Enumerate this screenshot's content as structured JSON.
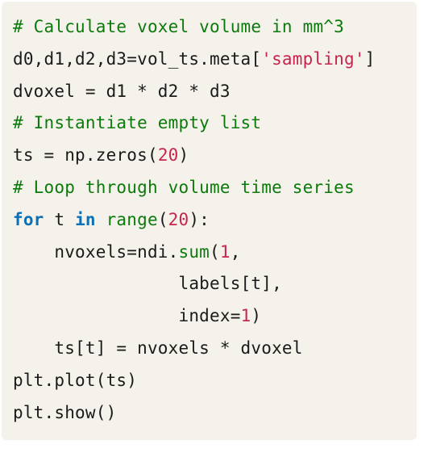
{
  "code_block": {
    "lines": [
      [
        {
          "type": "comment",
          "text": "# Calculate voxel volume in mm^3"
        }
      ],
      [
        {
          "type": "plain",
          "text": "d0,d1,d2,d3=vol_ts.meta["
        },
        {
          "type": "string",
          "text": "'sampling'"
        },
        {
          "type": "plain",
          "text": "]"
        }
      ],
      [
        {
          "type": "plain",
          "text": "dvoxel = d1 * d2 * d3"
        }
      ],
      [
        {
          "type": "comment",
          "text": "# Instantiate empty list"
        }
      ],
      [
        {
          "type": "plain",
          "text": "ts = np.zeros("
        },
        {
          "type": "number",
          "text": "20"
        },
        {
          "type": "plain",
          "text": ")"
        }
      ],
      [
        {
          "type": "comment",
          "text": "# Loop through volume time series"
        }
      ],
      [
        {
          "type": "keyword",
          "text": "for"
        },
        {
          "type": "plain",
          "text": " t "
        },
        {
          "type": "keyword",
          "text": "in"
        },
        {
          "type": "plain",
          "text": " "
        },
        {
          "type": "builtin",
          "text": "range"
        },
        {
          "type": "plain",
          "text": "("
        },
        {
          "type": "number",
          "text": "20"
        },
        {
          "type": "plain",
          "text": "):"
        }
      ],
      [
        {
          "type": "plain",
          "text": "    nvoxels=ndi."
        },
        {
          "type": "builtin",
          "text": "sum"
        },
        {
          "type": "plain",
          "text": "("
        },
        {
          "type": "number",
          "text": "1"
        },
        {
          "type": "plain",
          "text": ","
        }
      ],
      [
        {
          "type": "plain",
          "text": "                labels[t],"
        }
      ],
      [
        {
          "type": "plain",
          "text": "                index="
        },
        {
          "type": "number",
          "text": "1"
        },
        {
          "type": "plain",
          "text": ")"
        }
      ],
      [
        {
          "type": "plain",
          "text": "    ts[t] = nvoxels * dvoxel"
        }
      ],
      [
        {
          "type": "plain",
          "text": "plt.plot(ts)"
        }
      ],
      [
        {
          "type": "plain",
          "text": "plt.show()"
        }
      ]
    ]
  },
  "colors": {
    "background": "#f5f2eb",
    "comment": "#0b7a0b",
    "string": "#c7254e",
    "number": "#c7254e",
    "keyword": "#0a6fb3",
    "builtin": "#0b7a0b",
    "plain": "#1a1a1a"
  }
}
